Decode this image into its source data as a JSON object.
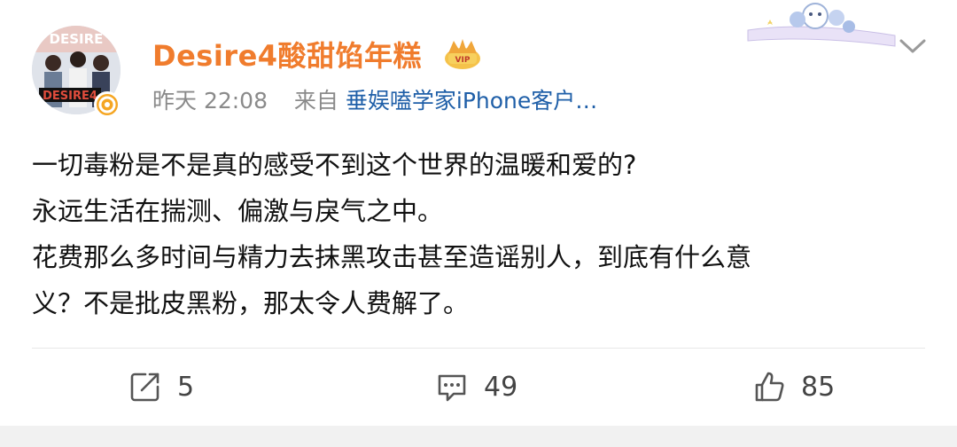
{
  "post": {
    "username": "Desire4酸甜馅年糕",
    "time": "昨天 22:08",
    "source_prefix": "来自",
    "source": "垂娱嗑学家iPhone客户…",
    "content": "一切毒粉是不是真的感受不到这个世界的温暖和爱的?\n永远生活在揣测、偏激与戾气之中。\n花费那么多时间与精力去抹黑攻击甚至造谣别人，到底有什么意\n义？不是批皮黑粉，那太令人费解了。",
    "avatar_text": "DESIRE",
    "avatar_text_top": "DESIRE"
  },
  "actions": {
    "repost_count": "5",
    "comment_count": "49",
    "like_count": "85"
  },
  "colors": {
    "username": "#f07c2d",
    "source_link": "#1f5fa8",
    "meta": "#8a8a8a",
    "verified": "#f5a623"
  },
  "icons": {
    "repost": "repost-icon",
    "comment": "comment-icon",
    "like": "thumbs-up-icon",
    "crown": "crown-badge-icon",
    "chevron": "chevron-down-icon",
    "verified": "verified-badge-icon"
  }
}
